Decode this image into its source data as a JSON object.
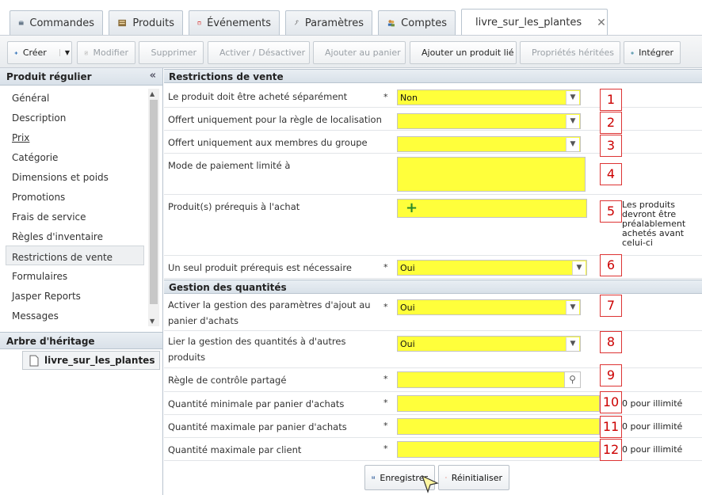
{
  "tabs": [
    {
      "label": "Commandes",
      "icon": "orders-icon"
    },
    {
      "label": "Produits",
      "icon": "products-icon"
    },
    {
      "label": "Événements",
      "icon": "calendar-icon"
    },
    {
      "label": "Paramètres",
      "icon": "wrench-icon"
    },
    {
      "label": "Comptes",
      "icon": "accounts-icon"
    },
    {
      "label": "livre_sur_les_plantes",
      "icon": "document-icon",
      "close": "✕"
    }
  ],
  "toolbar": {
    "create": "Créer",
    "modify": "Modifier",
    "delete": "Supprimer",
    "toggle": "Activer / Désactiver",
    "add_cart": "Ajouter au panier",
    "add_related": "Ajouter un produit lié",
    "inherited": "Propriétés héritées",
    "integrate": "Intégrer"
  },
  "left": {
    "header": "Produit régulier",
    "collapse": "«",
    "items": [
      {
        "label": "Général"
      },
      {
        "label": "Description"
      },
      {
        "label": "Prix"
      },
      {
        "label": "Catégorie"
      },
      {
        "label": "Dimensions et poids"
      },
      {
        "label": "Promotions"
      },
      {
        "label": "Frais de service"
      },
      {
        "label": "Règles d'inventaire"
      },
      {
        "label": "Restrictions de vente"
      },
      {
        "label": "Formulaires"
      },
      {
        "label": "Jasper Reports"
      },
      {
        "label": "Messages"
      }
    ],
    "selected_index": 8,
    "tree_header": "Arbre d'héritage",
    "tree_node": "livre_sur_les_plantes"
  },
  "form": {
    "section1": "Restrictions de vente",
    "section2": "Gestion des quantités",
    "required_mark": "*",
    "rows": [
      {
        "label": "Le produit doit être acheté séparément",
        "value": "Non",
        "num": "1"
      },
      {
        "label": "Offert uniquement pour la règle de localisation",
        "value": "",
        "num": "2"
      },
      {
        "label": "Offert uniquement aux membres du groupe",
        "value": "",
        "num": "3"
      },
      {
        "label": "Mode de paiement limité à",
        "value": "",
        "num": "4"
      },
      {
        "label": "Produit(s) prérequis à l'achat",
        "value": "",
        "num": "5",
        "hint": "Les produits devront être préalablement achetés avant celui-ci"
      },
      {
        "label": "Un seul produit prérequis est nécessaire",
        "value": "Oui",
        "num": "6"
      },
      {
        "label": "Activer la gestion des paramètres d'ajout au panier d'achats",
        "value": "Oui",
        "num": "7"
      },
      {
        "label": "Lier la gestion des quantités à d'autres produits",
        "value": "Oui",
        "num": "8"
      },
      {
        "label": "Règle de contrôle partagé",
        "value": "",
        "num": "9"
      },
      {
        "label": "Quantité minimale par panier d'achats",
        "value": "",
        "num": "10",
        "hint": "0 pour illimité"
      },
      {
        "label": "Quantité maximale par panier d'achats",
        "value": "",
        "num": "11",
        "hint": "0 pour illimité"
      },
      {
        "label": "Quantité maximale par client",
        "value": "",
        "num": "12",
        "hint": "0 pour illimité"
      }
    ]
  },
  "footer": {
    "save": "Enregistrer",
    "reset": "Réinitialiser"
  }
}
